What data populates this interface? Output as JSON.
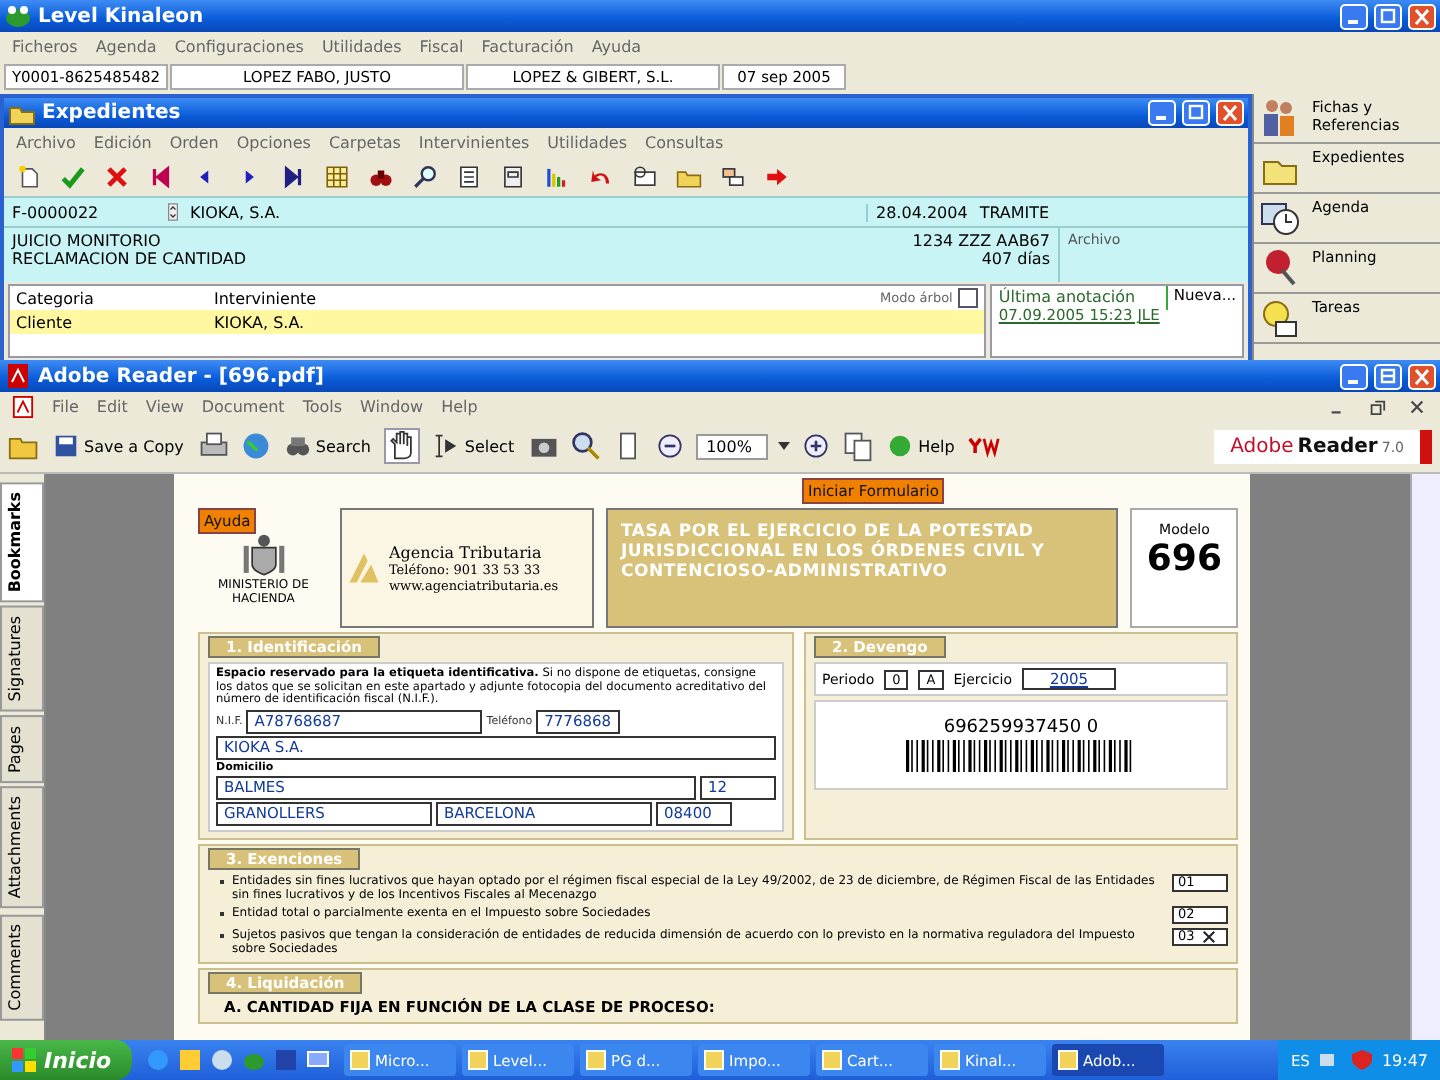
{
  "main_window": {
    "title": "Level Kinaleon",
    "menu": [
      "Ficheros",
      "Agenda",
      "Configuraciones",
      "Utilidades",
      "Fiscal",
      "Facturación",
      "Ayuda"
    ],
    "info_fields": [
      "Y0001-8625485482",
      "LOPEZ FABO, JUSTO",
      "LOPEZ & GIBERT, S.L.",
      "07 sep 2005"
    ]
  },
  "expedientes": {
    "title": "Expedientes",
    "menu": [
      "Archivo",
      "Edición",
      "Orden",
      "Opciones",
      "Carpetas",
      "Intervinientes",
      "Utilidades",
      "Consultas"
    ],
    "record": {
      "number": "F-0000022",
      "client": "KIOKA, S.A.",
      "date": "28.04.2004",
      "status": "TRAMITE",
      "description_lines": [
        "JUICIO MONITORIO",
        "RECLAMACION DE CANTIDAD"
      ],
      "reference": "1234 ZZZ AAB67",
      "days": "407 días",
      "archive_label": "Archivo"
    },
    "parties": {
      "columns": [
        "Categoria",
        "Interviniente"
      ],
      "tree_mode_label": "Modo árbol",
      "tree_mode_checked": false,
      "rows": [
        {
          "cells": [
            "Cliente",
            "KIOKA, S.A."
          ],
          "selected": true
        }
      ]
    },
    "last_note": {
      "label": "Última anotación",
      "value": "07.09.2005 15:23 JLE",
      "new_button": "Nueva..."
    }
  },
  "side_panel": {
    "items": [
      {
        "label": "Fichas y Referencias"
      },
      {
        "label": "Expedientes"
      },
      {
        "label": "Agenda"
      },
      {
        "label": "Planning"
      },
      {
        "label": "Tareas"
      }
    ]
  },
  "reader": {
    "title": "Adobe Reader - [696.pdf]",
    "menu": [
      "File",
      "Edit",
      "View",
      "Document",
      "Tools",
      "Window",
      "Help"
    ],
    "toolbar": {
      "save_copy": "Save a Copy",
      "search": "Search",
      "select": "Select",
      "zoom": "100%",
      "help": "Help"
    },
    "brand": {
      "name": "Adobe",
      "product": "Reader",
      "version": "7.0"
    },
    "nav_tabs": [
      {
        "label": "Bookmarks",
        "selected": true
      },
      {
        "label": "Signatures",
        "selected": false
      },
      {
        "label": "Pages",
        "selected": false
      },
      {
        "label": "Attachments",
        "selected": false
      },
      {
        "label": "Comments",
        "selected": false
      }
    ],
    "document": {
      "help_button": "Ayuda",
      "start_button": "Iniciar Formulario",
      "ministry": "MINISTERIO DE HACIENDA",
      "agency": {
        "name": "Agencia Tributaria",
        "phone": "Teléfono: 901 33 53 33",
        "web": "www.agenciatributaria.es"
      },
      "form_title": "TASA POR EL EJERCICIO DE LA POTESTAD JURISDICCIONAL EN LOS ÓRDENES CIVIL Y CONTENCIOSO-ADMINISTRATIVO",
      "model": {
        "label": "Modelo",
        "number": "696"
      },
      "identification": {
        "heading": "1. Identificación",
        "note": "**Espacio reservado para la etiqueta identificativa.** Si no dispone de etiquetas, consigne los datos que se solicitan en este apartado y adjunte fotocopia del documento acreditativo del número de identificación fiscal (N.I.F.).",
        "nif_label": "N.I.F.",
        "nif": "A78768687",
        "phone_label": "Teléfono",
        "phone": "7776868",
        "name": "KIOKA S.A.",
        "address_label": "Domicilio",
        "street": "BALMES",
        "street_number": "12",
        "city": "GRANOLLERS",
        "province": "BARCELONA",
        "postcode": "08400"
      },
      "devengo": {
        "heading": "2. Devengo",
        "period_label": "Periodo",
        "period_boxes": [
          "0",
          "A"
        ],
        "year_label": "Ejercicio",
        "year": "2005",
        "barcode_number": "696259937450 0"
      },
      "exemptions": {
        "heading": "3. Exenciones",
        "items": [
          {
            "text": "Entidades sin fines lucrativos que hayan optado por el régimen fiscal especial de la Ley 49/2002, de 23 de diciembre, de Régimen Fiscal de las Entidades sin fines lucrativos y de los Incentivos Fiscales al Mecenazgo",
            "code": "01",
            "checked": false
          },
          {
            "text": "Entidad total o parcialmente exenta en el Impuesto sobre Sociedades",
            "code": "02",
            "checked": false
          },
          {
            "text": "Sujetos pasivos que tengan la consideración de entidades de reducida dimensión de acuerdo con lo previsto en la normativa reguladora del Impuesto sobre Sociedades",
            "code": "03",
            "checked": true
          }
        ]
      },
      "liquidation": {
        "heading": "4. Liquidación",
        "line": "A.   CANTIDAD FIJA EN FUNCIÓN DE LA CLASE DE PROCESO:"
      }
    }
  },
  "taskbar": {
    "start": "Inicio",
    "tasks": [
      {
        "label": "Micro...",
        "selected": false
      },
      {
        "label": "Level...",
        "selected": false
      },
      {
        "label": "PG d...",
        "selected": false
      },
      {
        "label": "Impo...",
        "selected": false
      },
      {
        "label": "Cart...",
        "selected": false
      },
      {
        "label": "Kinal...",
        "selected": false
      },
      {
        "label": "Adob...",
        "selected": true
      }
    ],
    "language": "ES",
    "clock": "19:47"
  }
}
